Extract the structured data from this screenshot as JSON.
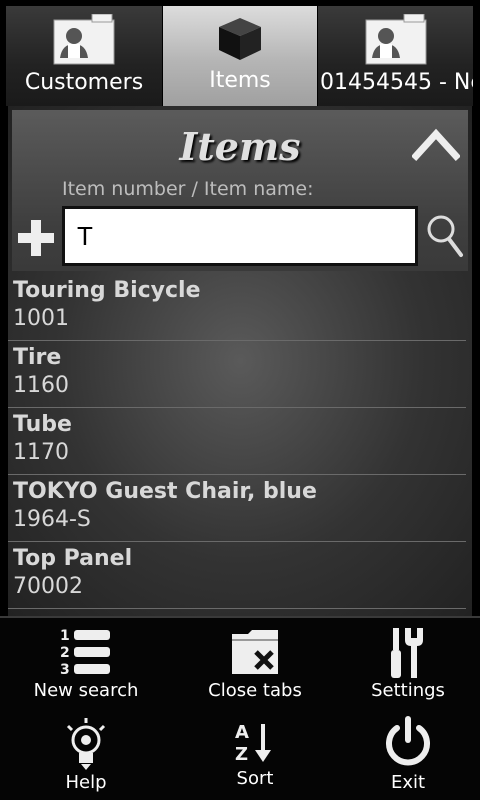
{
  "tabs": [
    {
      "label": "Customers",
      "active": false,
      "icon": "contact-card-icon"
    },
    {
      "label": "Items",
      "active": true,
      "icon": "box-icon"
    },
    {
      "label": "01454545 - Ne",
      "active": false,
      "icon": "contact-card-icon"
    }
  ],
  "panel": {
    "title": "Items",
    "field_label": "Item number / Item name:",
    "search_value": "T"
  },
  "items": [
    {
      "name": "Touring Bicycle",
      "number": "1001"
    },
    {
      "name": "Tire",
      "number": "1160"
    },
    {
      "name": "Tube",
      "number": "1170"
    },
    {
      "name": "TOKYO Guest Chair, blue",
      "number": "1964-S"
    },
    {
      "name": "Top Panel",
      "number": "70002"
    }
  ],
  "menu": [
    {
      "label": "New search",
      "icon": "numbered-list-icon"
    },
    {
      "label": "Close tabs",
      "icon": "close-folder-icon"
    },
    {
      "label": "Settings",
      "icon": "tools-icon"
    },
    {
      "label": "Help",
      "icon": "lightbulb-icon"
    },
    {
      "label": "Sort",
      "icon": "sort-az-icon"
    },
    {
      "label": "Exit",
      "icon": "power-icon"
    }
  ]
}
